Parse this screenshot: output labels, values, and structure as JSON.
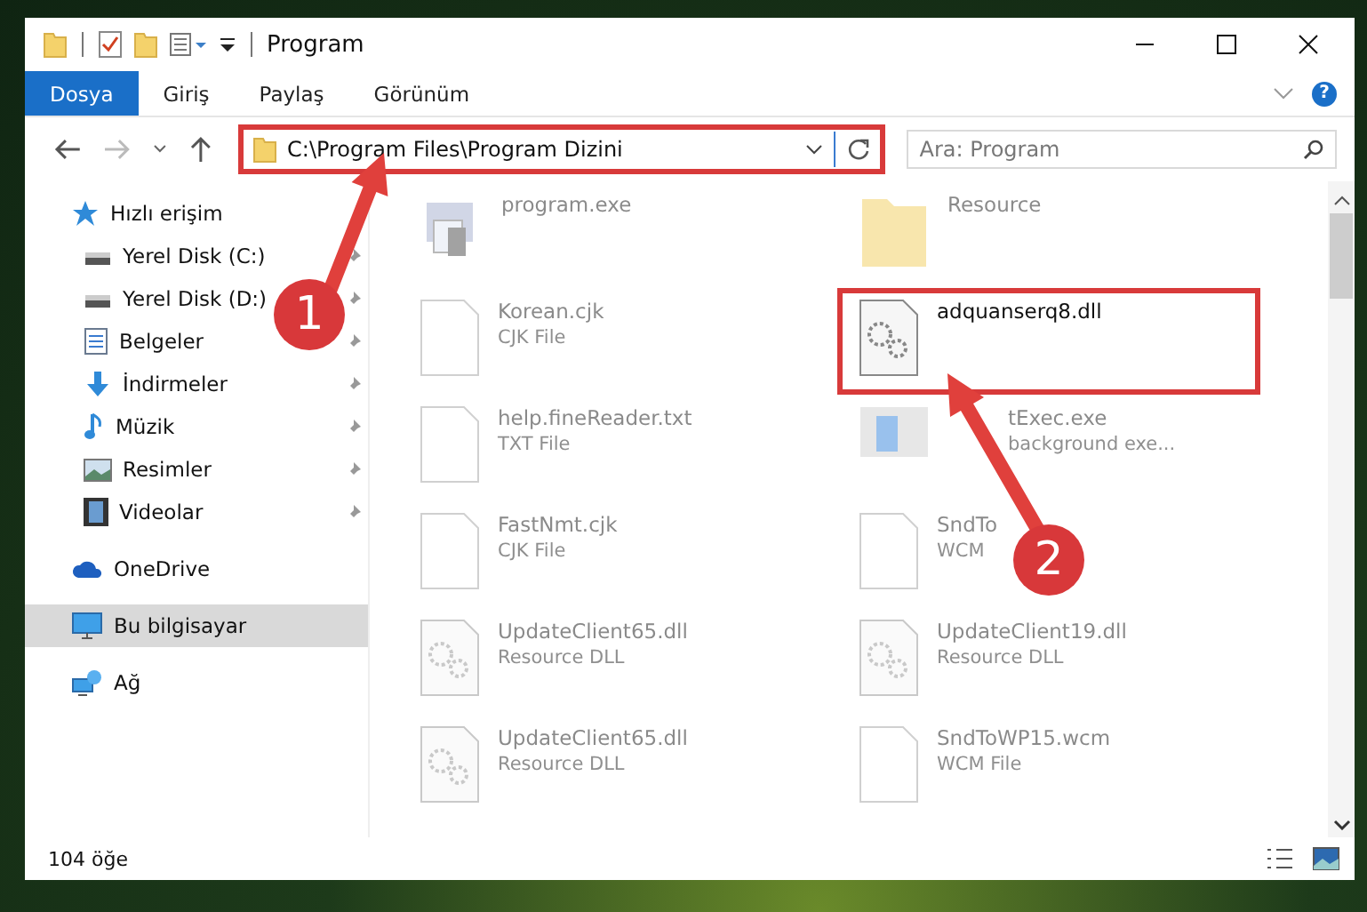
{
  "window": {
    "title": "Program"
  },
  "ribbon": {
    "tabs": [
      {
        "label": "Dosya",
        "kind": "file"
      },
      {
        "label": "Giriş",
        "kind": "tab"
      },
      {
        "label": "Paylaş",
        "kind": "tab"
      },
      {
        "label": "Görünüm",
        "kind": "tab"
      }
    ],
    "help_button": "?"
  },
  "address_bar": {
    "path": "C:\\Program Files\\Program Dizini",
    "highlighted": true
  },
  "search": {
    "placeholder": "Ara: Program"
  },
  "sidebar": {
    "items": [
      {
        "label": "Hızlı erişim",
        "pinned": false,
        "selected": false
      },
      {
        "label": "Yerel Disk (C:)",
        "pinned": true,
        "selected": false
      },
      {
        "label": "Yerel Disk (D:)",
        "pinned": true,
        "selected": false
      },
      {
        "label": "Belgeler",
        "pinned": true,
        "selected": false
      },
      {
        "label": "İndirmeler",
        "pinned": true,
        "selected": false
      },
      {
        "label": "Müzik",
        "pinned": true,
        "selected": false
      },
      {
        "label": "Resimler",
        "pinned": true,
        "selected": false
      },
      {
        "label": "Videolar",
        "pinned": true,
        "selected": false
      },
      {
        "label": "OneDrive",
        "pinned": false,
        "selected": false
      },
      {
        "label": "Bu bilgisayar",
        "pinned": false,
        "selected": true
      },
      {
        "label": "Ağ",
        "pinned": false,
        "selected": false
      }
    ]
  },
  "files": [
    {
      "name": "program.exe",
      "faded": true,
      "highlighted": false
    },
    {
      "name": "Resource",
      "faded": true,
      "highlighted": false
    },
    {
      "name": "Korean.cjk",
      "type": "CJK File",
      "faded": true,
      "highlighted": false
    },
    {
      "name": "adquanserq8.dll",
      "faded": false,
      "highlighted": true
    },
    {
      "name": "help.fineReader.txt",
      "type": "TXT File",
      "faded": true,
      "highlighted": false
    },
    {
      "name": "tExec.exe",
      "type": "background exe...",
      "faded": true,
      "highlighted": false
    },
    {
      "name": "FastNmt.cjk",
      "type": "CJK File",
      "faded": true,
      "highlighted": false
    },
    {
      "name": "SndTo",
      "type": "WCM",
      "faded": true,
      "highlighted": false
    },
    {
      "name": "UpdateClient65.dll",
      "type": "Resource DLL",
      "faded": true,
      "highlighted": false
    },
    {
      "name": "UpdateClient19.dll",
      "type": "Resource DLL",
      "faded": true,
      "highlighted": false
    },
    {
      "name": "UpdateClient65.dll",
      "type": "Resource DLL",
      "faded": true,
      "highlighted": false
    },
    {
      "name": "SndToWP15.wcm",
      "type": "WCM File",
      "faded": true,
      "highlighted": false
    }
  ],
  "status_bar": {
    "item_count": "104 öğe"
  },
  "annotations": [
    {
      "number": "1"
    },
    {
      "number": "2"
    }
  ]
}
